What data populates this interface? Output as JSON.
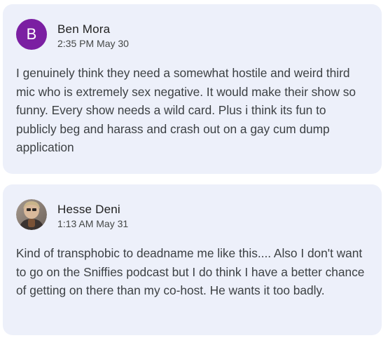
{
  "comments": [
    {
      "avatar_letter": "B",
      "avatar_color": "#7b1fa2",
      "author": "Ben Mora",
      "timestamp": "2:35 PM May 30",
      "text": "I genuinely think they need a somewhat hostile and weird third mic who is extremely sex negative. It would make their show so funny. Every show needs a wild card. Plus i think its fun to publicly beg and harass and crash out on a gay cum dump application"
    },
    {
      "avatar_type": "photo",
      "author": "Hesse Deni",
      "timestamp": "1:13 AM May 31",
      "text": "Kind of transphobic to deadname me like this.... Also I don't want to go on the Sniffies podcast but I do think I have a better chance of getting on there than my co-host. He wants it too badly."
    }
  ]
}
